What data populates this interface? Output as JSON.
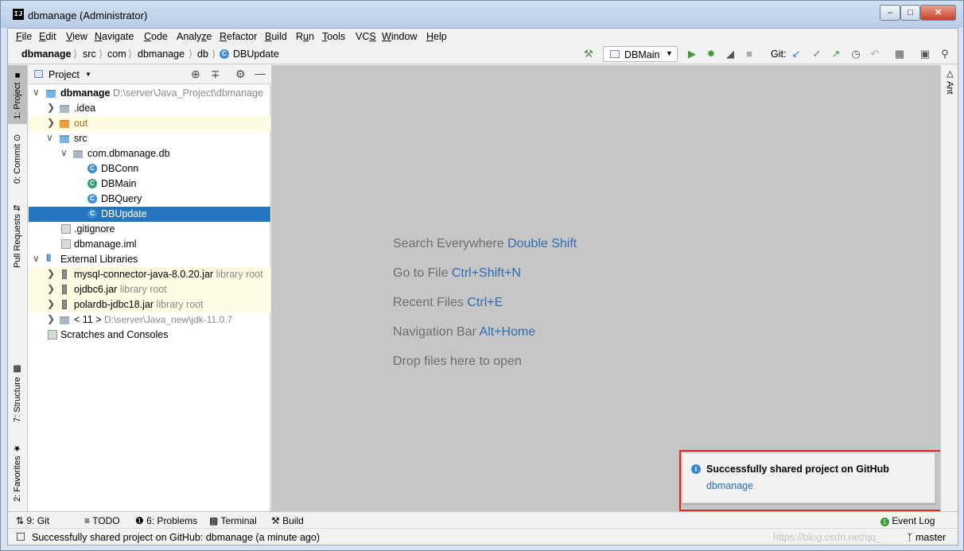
{
  "window": {
    "title": "dbmanage (Administrator)",
    "app_icon": "IJ",
    "controls": [
      "minimize-icon",
      "maximize-icon",
      "close-icon"
    ]
  },
  "menu": [
    "File",
    "Edit",
    "View",
    "Navigate",
    "Code",
    "Analyze",
    "Refactor",
    "Build",
    "Run",
    "Tools",
    "VCS",
    "Window",
    "Help"
  ],
  "breadcrumb": [
    "dbmanage",
    "src",
    "com",
    "dbmanage",
    "db",
    "DBUpdate"
  ],
  "toolbar": {
    "run_config": "DBMain",
    "git_label": "Git:"
  },
  "left_tabs": {
    "project": "1: Project",
    "commit": "0: Commit",
    "pull_requests": "Pull Requests",
    "structure": "7: Structure",
    "favorites": "2: Favorites"
  },
  "right_tabs": {
    "ant": "Ant"
  },
  "project_panel": {
    "title": "Project",
    "tree": [
      {
        "label": "dbmanage",
        "hint": "D:\\server\\Java_Project\\dbmanage",
        "icon": "module-folder-icon"
      },
      {
        "label": ".idea",
        "hint": "",
        "icon": "folder-icon"
      },
      {
        "label": "out",
        "hint": "",
        "icon": "folder-icon"
      },
      {
        "label": "src",
        "hint": "",
        "icon": "source-folder-icon"
      },
      {
        "label": "com.dbmanage.db",
        "hint": "",
        "icon": "package-icon"
      },
      {
        "label": "DBConn",
        "hint": "",
        "icon": "class-icon"
      },
      {
        "label": "DBMain",
        "hint": "",
        "icon": "main-class-icon"
      },
      {
        "label": "DBQuery",
        "hint": "",
        "icon": "class-icon"
      },
      {
        "label": "DBUpdate",
        "hint": "",
        "icon": "class-icon"
      },
      {
        "label": ".gitignore",
        "hint": "",
        "icon": "file-icon"
      },
      {
        "label": "dbmanage.iml",
        "hint": "",
        "icon": "file-icon"
      },
      {
        "label": "External Libraries",
        "hint": "",
        "icon": "library-icon"
      },
      {
        "label": "mysql-connector-java-8.0.20.jar",
        "hint": "library root",
        "icon": "jar-icon"
      },
      {
        "label": "ojdbc6.jar",
        "hint": "library root",
        "icon": "jar-icon"
      },
      {
        "label": "polardb-jdbc18.jar",
        "hint": "library root",
        "icon": "jar-icon"
      },
      {
        "label": "< 11 >",
        "hint": "D:\\server\\Java_new\\jdk-11.0.7",
        "icon": "sdk-icon"
      },
      {
        "label": "Scratches and Consoles",
        "hint": "",
        "icon": "scratches-icon"
      }
    ]
  },
  "editor_tips": [
    {
      "text": "Search Everywhere",
      "shortcut": "Double Shift"
    },
    {
      "text": "Go to File",
      "shortcut": "Ctrl+Shift+N"
    },
    {
      "text": "Recent Files",
      "shortcut": "Ctrl+E"
    },
    {
      "text": "Navigation Bar",
      "shortcut": "Alt+Home"
    },
    {
      "text": "Drop files here to open",
      "shortcut": ""
    }
  ],
  "notification": {
    "title": "Successfully shared project on GitHub",
    "link": "dbmanage"
  },
  "bottom_tabs": {
    "git": "9: Git",
    "todo": "TODO",
    "problems": "6: Problems",
    "terminal": "Terminal",
    "build": "Build",
    "event_log": "Event Log"
  },
  "status": {
    "message": "Successfully shared project on GitHub: dbmanage (a minute ago)",
    "branch": "master",
    "watermark": "https://blog.csdn.net/qq_"
  }
}
